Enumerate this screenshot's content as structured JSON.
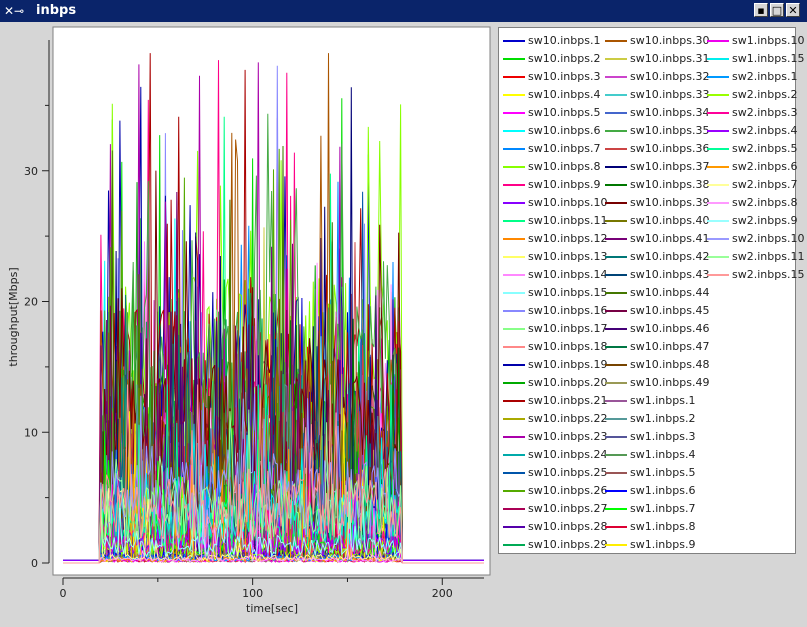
{
  "window": {
    "title": "inbps",
    "icon": "x-window-icon"
  },
  "chart_data": {
    "type": "line",
    "xlabel": "time[sec]",
    "ylabel": "throughput[Mbps]",
    "xlim": [
      0,
      222
    ],
    "ylim": [
      0,
      40
    ],
    "xticks": [
      0,
      100,
      200
    ],
    "yticks": [
      0,
      10,
      20,
      30
    ],
    "active_range": [
      20,
      178
    ],
    "legend_position": "right"
  },
  "legend": [
    {
      "name": "sw10.inbps.1",
      "color": "#0000cc"
    },
    {
      "name": "sw10.inbps.2",
      "color": "#00dd00"
    },
    {
      "name": "sw10.inbps.3",
      "color": "#ee0000"
    },
    {
      "name": "sw10.inbps.4",
      "color": "#ffff00"
    },
    {
      "name": "sw10.inbps.5",
      "color": "#ff00ff"
    },
    {
      "name": "sw10.inbps.6",
      "color": "#00ffff"
    },
    {
      "name": "sw10.inbps.7",
      "color": "#0088ff"
    },
    {
      "name": "sw10.inbps.8",
      "color": "#88ff00"
    },
    {
      "name": "sw10.inbps.9",
      "color": "#ff0088"
    },
    {
      "name": "sw10.inbps.10",
      "color": "#8800ff"
    },
    {
      "name": "sw10.inbps.11",
      "color": "#00ff88"
    },
    {
      "name": "sw10.inbps.12",
      "color": "#ff8800"
    },
    {
      "name": "sw10.inbps.13",
      "color": "#ffff66"
    },
    {
      "name": "sw10.inbps.14",
      "color": "#ff88ff"
    },
    {
      "name": "sw10.inbps.15",
      "color": "#88ffff"
    },
    {
      "name": "sw10.inbps.16",
      "color": "#8888ff"
    },
    {
      "name": "sw10.inbps.17",
      "color": "#88ff88"
    },
    {
      "name": "sw10.inbps.18",
      "color": "#ff8888"
    },
    {
      "name": "sw10.inbps.19",
      "color": "#0000aa"
    },
    {
      "name": "sw10.inbps.20",
      "color": "#00aa00"
    },
    {
      "name": "sw10.inbps.21",
      "color": "#aa0000"
    },
    {
      "name": "sw10.inbps.22",
      "color": "#aaaa00"
    },
    {
      "name": "sw10.inbps.23",
      "color": "#aa00aa"
    },
    {
      "name": "sw10.inbps.24",
      "color": "#00aaaa"
    },
    {
      "name": "sw10.inbps.25",
      "color": "#0055aa"
    },
    {
      "name": "sw10.inbps.26",
      "color": "#55aa00"
    },
    {
      "name": "sw10.inbps.27",
      "color": "#aa0055"
    },
    {
      "name": "sw10.inbps.28",
      "color": "#5500aa"
    },
    {
      "name": "sw10.inbps.29",
      "color": "#00aa55"
    },
    {
      "name": "sw10.inbps.30",
      "color": "#aa5500"
    },
    {
      "name": "sw10.inbps.31",
      "color": "#cccc44"
    },
    {
      "name": "sw10.inbps.32",
      "color": "#cc44cc"
    },
    {
      "name": "sw10.inbps.33",
      "color": "#44cccc"
    },
    {
      "name": "sw10.inbps.34",
      "color": "#4466cc"
    },
    {
      "name": "sw10.inbps.35",
      "color": "#44aa44"
    },
    {
      "name": "sw10.inbps.36",
      "color": "#cc4444"
    },
    {
      "name": "sw10.inbps.37",
      "color": "#000077"
    },
    {
      "name": "sw10.inbps.38",
      "color": "#007700"
    },
    {
      "name": "sw10.inbps.39",
      "color": "#770000"
    },
    {
      "name": "sw10.inbps.40",
      "color": "#777700"
    },
    {
      "name": "sw10.inbps.41",
      "color": "#770077"
    },
    {
      "name": "sw10.inbps.42",
      "color": "#007777"
    },
    {
      "name": "sw10.inbps.43",
      "color": "#004477"
    },
    {
      "name": "sw10.inbps.44",
      "color": "#447700"
    },
    {
      "name": "sw10.inbps.45",
      "color": "#770044"
    },
    {
      "name": "sw10.inbps.46",
      "color": "#440077"
    },
    {
      "name": "sw10.inbps.47",
      "color": "#007744"
    },
    {
      "name": "sw10.inbps.48",
      "color": "#774400"
    },
    {
      "name": "sw10.inbps.49",
      "color": "#999955"
    },
    {
      "name": "sw1.inbps.1",
      "color": "#995599"
    },
    {
      "name": "sw1.inbps.2",
      "color": "#559999"
    },
    {
      "name": "sw1.inbps.3",
      "color": "#555599"
    },
    {
      "name": "sw1.inbps.4",
      "color": "#559955"
    },
    {
      "name": "sw1.inbps.5",
      "color": "#995555"
    },
    {
      "name": "sw1.inbps.6",
      "color": "#0000ff"
    },
    {
      "name": "sw1.inbps.7",
      "color": "#00ff00"
    },
    {
      "name": "sw1.inbps.8",
      "color": "#dd0033"
    },
    {
      "name": "sw1.inbps.9",
      "color": "#ffee00"
    },
    {
      "name": "sw1.inbps.10",
      "color": "#ee00ee"
    },
    {
      "name": "sw1.inbps.15",
      "color": "#00eeee"
    },
    {
      "name": "sw2.inbps.1",
      "color": "#0099ff"
    },
    {
      "name": "sw2.inbps.2",
      "color": "#99ff00"
    },
    {
      "name": "sw2.inbps.3",
      "color": "#ff0099"
    },
    {
      "name": "sw2.inbps.4",
      "color": "#9900ff"
    },
    {
      "name": "sw2.inbps.5",
      "color": "#00ff99"
    },
    {
      "name": "sw2.inbps.6",
      "color": "#ff9900"
    },
    {
      "name": "sw2.inbps.7",
      "color": "#ffff99"
    },
    {
      "name": "sw2.inbps.8",
      "color": "#ff99ff"
    },
    {
      "name": "sw2.inbps.9",
      "color": "#99ffff"
    },
    {
      "name": "sw2.inbps.10",
      "color": "#9999ff"
    },
    {
      "name": "sw2.inbps.11",
      "color": "#99ff99"
    },
    {
      "name": "sw2.inbps.15",
      "color": "#ff9999"
    }
  ]
}
